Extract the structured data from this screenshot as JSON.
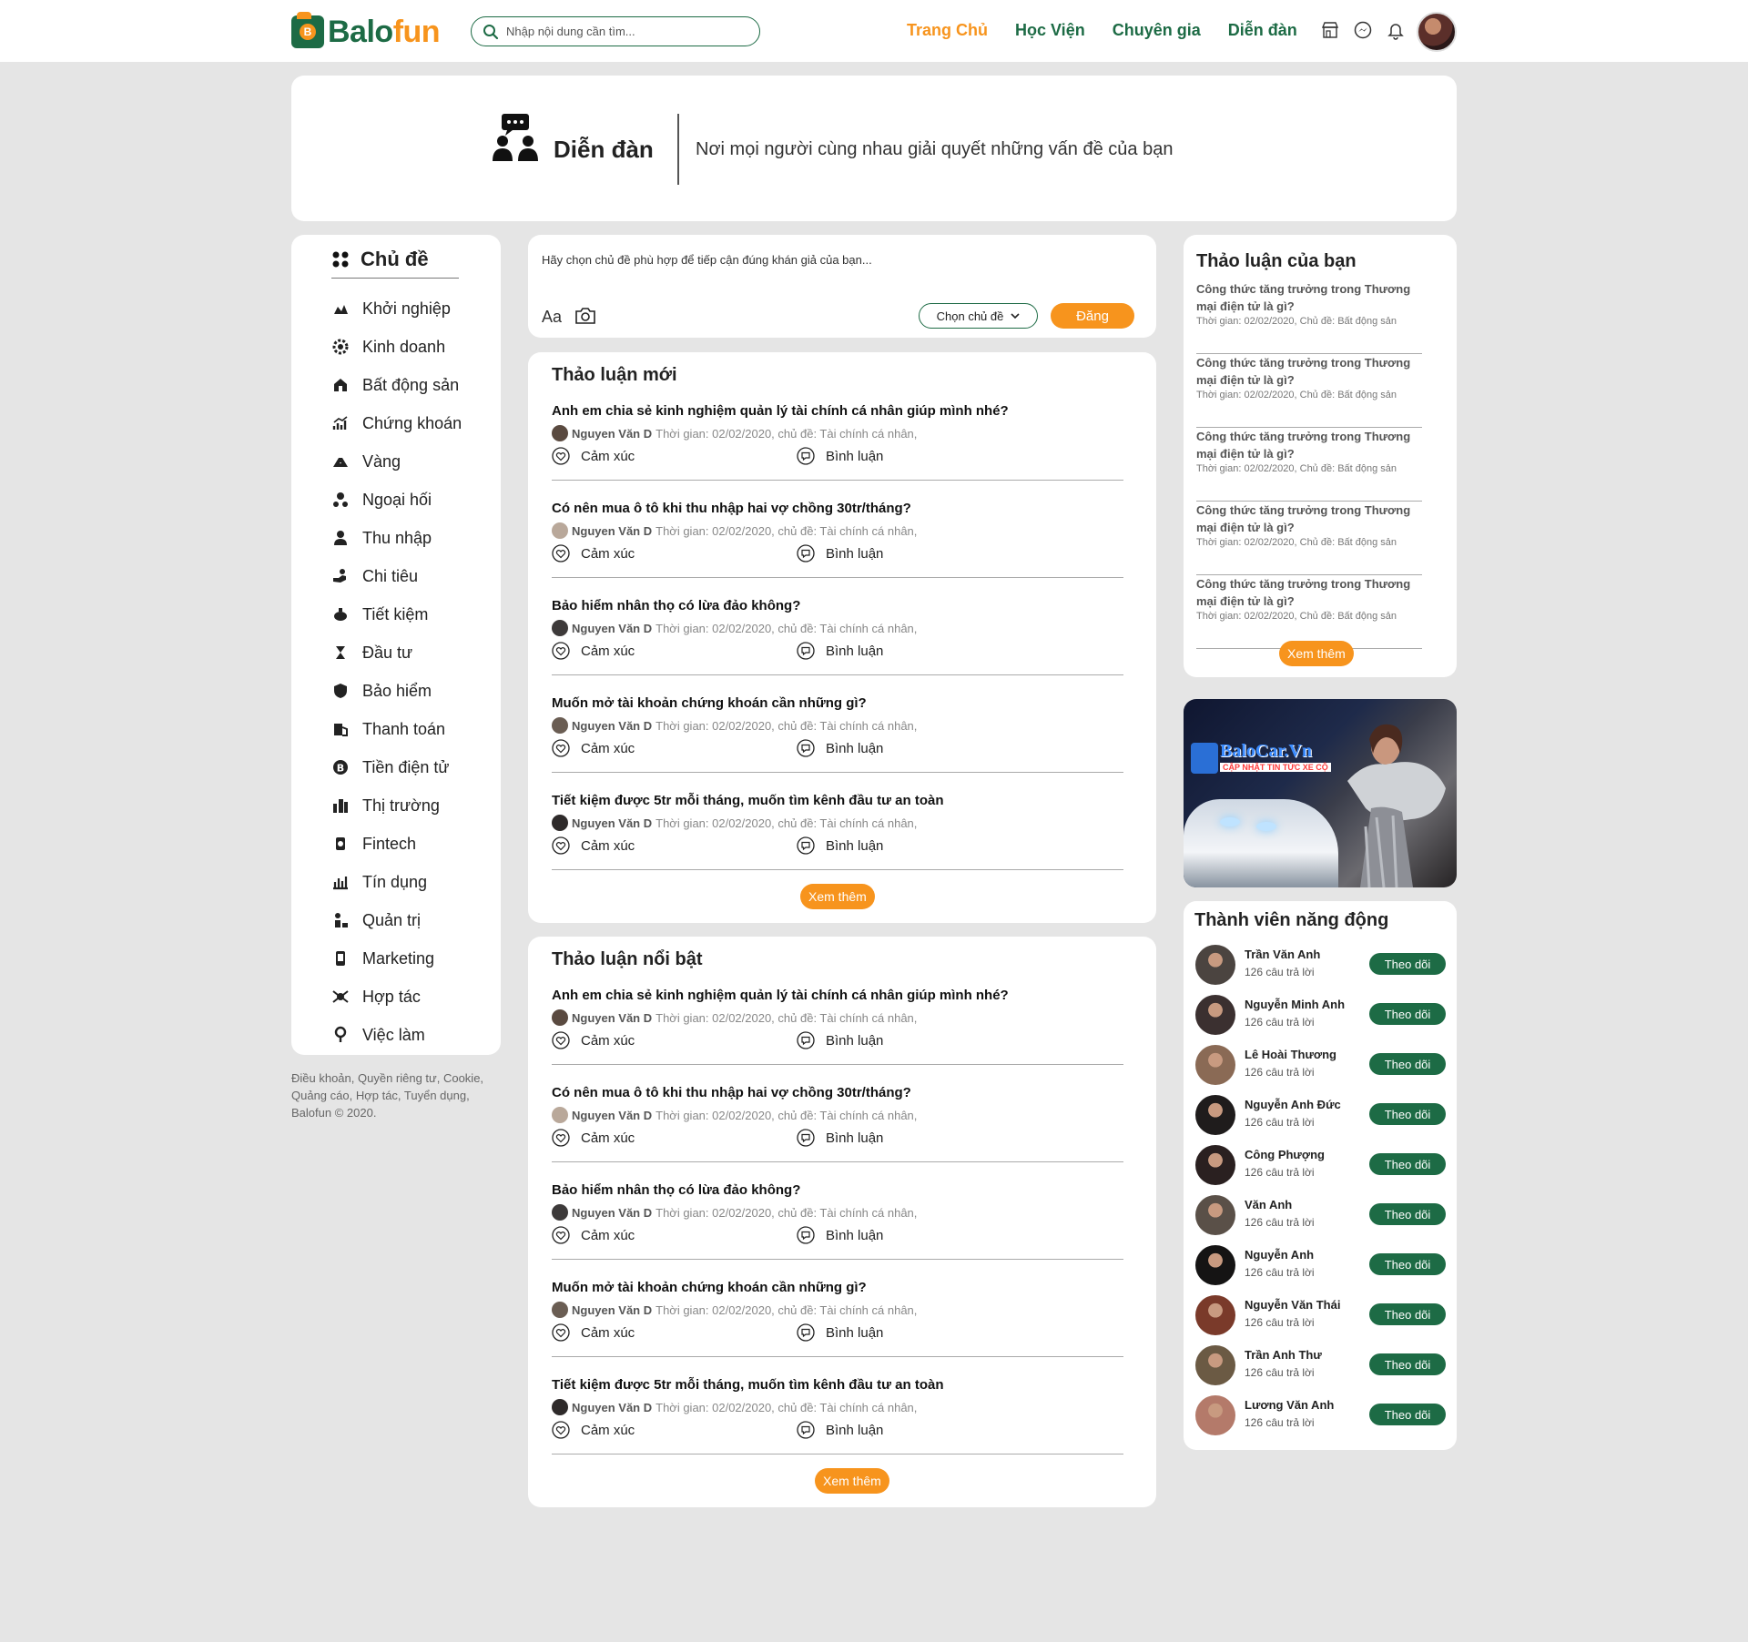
{
  "header": {
    "logo_text_a": "Balo",
    "logo_text_b": "fun",
    "logo_coin": "B",
    "search_placeholder": "Nhập nội dung cần tìm...",
    "nav": [
      "Trang Chủ",
      "Học Viện",
      "Chuyên gia",
      "Diễn đàn"
    ],
    "active_nav": "Trang Chủ"
  },
  "banner": {
    "title": "Diễn đàn",
    "description": "Nơi mọi người cùng nhau giải quyết những vấn đề của bạn"
  },
  "sidebar": {
    "heading": "Chủ đề",
    "items": [
      "Khởi nghiệp",
      "Kinh doanh",
      "Bất động sản",
      "Chứng khoán",
      "Vàng",
      "Ngoại hối",
      "Thu nhập",
      "Chi tiêu",
      "Tiết kiệm",
      "Đầu tư",
      "Bảo hiểm",
      "Thanh toán",
      "Tiền điện tử",
      "Thị trường",
      "Fintech",
      "Tín dụng",
      "Quản trị",
      "Marketing",
      "Hợp tác",
      "Việc làm"
    ],
    "footer_line1": "Điều khoản, Quyền riêng tư, Cookie,",
    "footer_line2": "Quảng cáo, Hợp tác, Tuyển dụng,",
    "footer_line3": "Balofun © 2020."
  },
  "composer": {
    "placeholder": "Hãy chọn chủ đề phù hợp để tiếp cận đúng khán giả của bạn...",
    "font_label": "Aa",
    "topic_select": "Chọn chủ đề",
    "post_button": "Đăng"
  },
  "new_discussions": {
    "title": "Thảo luận mới",
    "more": "Xem thêm",
    "posts": [
      {
        "question": "Anh em chia sẻ kinh nghiệm quản lý tài chính cá nhân giúp mình nhé?",
        "author": "Nguyen Văn D",
        "meta": "Thời gian: 02/02/2020, chủ đề: Tài chính cá nhân,",
        "react": "Cảm xúc",
        "comment": "Bình luận"
      },
      {
        "question": "Có nên mua ô tô khi thu nhập hai vợ chồng 30tr/tháng?",
        "author": "Nguyen Văn D",
        "meta": "Thời gian: 02/02/2020, chủ đề: Tài chính cá nhân,",
        "react": "Cảm xúc",
        "comment": "Bình luận"
      },
      {
        "question": "Bảo hiểm nhân thọ có lừa đảo không?",
        "author": "Nguyen Văn D",
        "meta": "Thời gian: 02/02/2020, chủ đề: Tài chính cá nhân,",
        "react": "Cảm xúc",
        "comment": "Bình luận"
      },
      {
        "question": "Muốn mở tài khoản chứng khoán cần những gì?",
        "author": "Nguyen Văn D",
        "meta": "Thời gian: 02/02/2020, chủ đề: Tài chính cá nhân,",
        "react": "Cảm xúc",
        "comment": "Bình luận"
      },
      {
        "question": "Tiết kiệm được 5tr mỗi tháng, muốn tìm kênh đầu tư an toàn",
        "author": "Nguyen Văn D",
        "meta": "Thời gian: 02/02/2020, chủ đề: Tài chính cá nhân,",
        "react": "Cảm xúc",
        "comment": "Bình luận"
      }
    ]
  },
  "hot_discussions": {
    "title": "Thảo luận nổi bật",
    "more": "Xem thêm",
    "posts": [
      {
        "question": "Anh em chia sẻ kinh nghiệm quản lý tài chính cá nhân giúp mình nhé?",
        "author": "Nguyen Văn D",
        "meta": "Thời gian: 02/02/2020, chủ đề: Tài chính cá nhân,",
        "react": "Cảm xúc",
        "comment": "Bình luận"
      },
      {
        "question": "Có nên mua ô tô khi thu nhập hai vợ chồng 30tr/tháng?",
        "author": "Nguyen Văn D",
        "meta": "Thời gian: 02/02/2020, chủ đề: Tài chính cá nhân,",
        "react": "Cảm xúc",
        "comment": "Bình luận"
      },
      {
        "question": "Bảo hiểm nhân thọ có lừa đảo không?",
        "author": "Nguyen Văn D",
        "meta": "Thời gian: 02/02/2020, chủ đề: Tài chính cá nhân,",
        "react": "Cảm xúc",
        "comment": "Bình luận"
      },
      {
        "question": "Muốn mở tài khoản chứng khoán cần những gì?",
        "author": "Nguyen Văn D",
        "meta": "Thời gian: 02/02/2020, chủ đề: Tài chính cá nhân,",
        "react": "Cảm xúc",
        "comment": "Bình luận"
      },
      {
        "question": "Tiết kiệm được 5tr mỗi tháng, muốn tìm kênh đầu tư an toàn",
        "author": "Nguyen Văn D",
        "meta": "Thời gian: 02/02/2020, chủ đề: Tài chính cá nhân,",
        "react": "Cảm xúc",
        "comment": "Bình luận"
      }
    ]
  },
  "your_discussions": {
    "title": "Thảo luận của bạn",
    "more": "Xem thêm",
    "items": [
      {
        "question": "Công thức tăng trưởng trong Thương mại điện tử là gì?",
        "meta": "Thời gian: 02/02/2020, Chủ đề: Bất động sản"
      },
      {
        "question": "Công thức tăng trưởng trong Thương mại điện tử là gì?",
        "meta": "Thời gian: 02/02/2020, Chủ đề: Bất động sản"
      },
      {
        "question": "Công thức tăng trưởng trong Thương mại điện tử là gì?",
        "meta": "Thời gian: 02/02/2020, Chủ đề: Bất động sản"
      },
      {
        "question": "Công thức tăng trưởng trong Thương mại điện tử là gì?",
        "meta": "Thời gian: 02/02/2020, Chủ đề: Bất động sản"
      },
      {
        "question": "Công thức tăng trưởng trong Thương mại điện tử là gì?",
        "meta": "Thời gian: 02/02/2020, Chủ đề: Bất động sản"
      }
    ]
  },
  "ad": {
    "brand": "BaloCar.Vn",
    "tagline": "CẬP NHẬT TIN TỨC XE CỘ"
  },
  "members": {
    "title": "Thành viên năng động",
    "follow_label": "Theo dõi",
    "list": [
      {
        "name": "Trần Văn Anh",
        "answers": "126 câu trả lời"
      },
      {
        "name": "Nguyễn Minh Anh",
        "answers": "126 câu trả lời"
      },
      {
        "name": "Lê Hoài Thương",
        "answers": "126 câu trả lời"
      },
      {
        "name": "Nguyễn Anh Đức",
        "answers": "126 câu trả lời"
      },
      {
        "name": "Công Phượng",
        "answers": "126 câu trả lời"
      },
      {
        "name": "Văn Anh",
        "answers": "126 câu trả lời"
      },
      {
        "name": "Nguyễn Anh",
        "answers": "126 câu trả lời"
      },
      {
        "name": "Nguyễn Văn Thái",
        "answers": "126 câu trả lời"
      },
      {
        "name": "Trần Anh Thư",
        "answers": "126 câu trả lời"
      },
      {
        "name": "Lương Văn Anh",
        "answers": "126 câu trả lời"
      }
    ]
  },
  "colors": {
    "brand_green": "#1d6b45",
    "brand_orange": "#f7941d",
    "page_bg": "#e5e5e5"
  }
}
